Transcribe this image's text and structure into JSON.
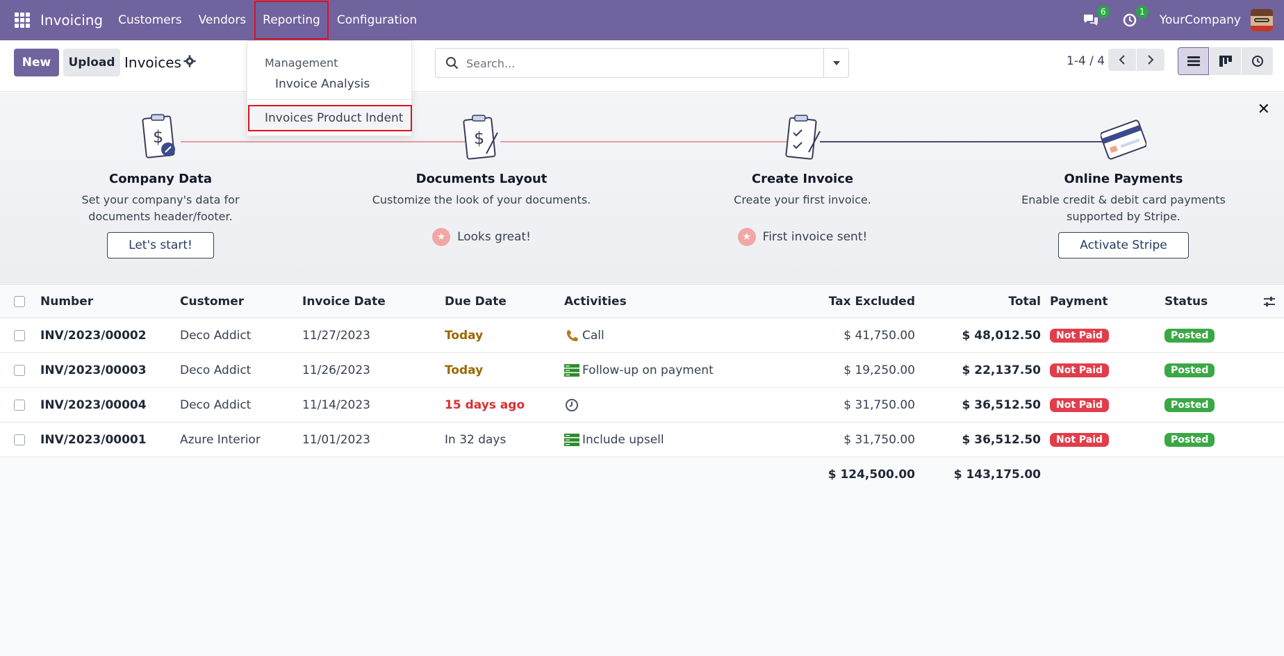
{
  "navbar": {
    "brand": "Invoicing",
    "menu": [
      "Customers",
      "Vendors",
      "Reporting",
      "Configuration"
    ],
    "messages_count": "6",
    "activities_count": "1",
    "company": "YourCompany"
  },
  "reporting_menu": {
    "section_header": "Management",
    "items": [
      "Invoice Analysis",
      "Invoices Product Indent"
    ]
  },
  "control": {
    "new_label": "New",
    "upload_label": "Upload",
    "title": "Invoices",
    "search_placeholder": "Search...",
    "pager": "1-4 / 4"
  },
  "onboarding": {
    "steps": [
      {
        "title": "Company Data",
        "desc": "Set your company's data for documents header/footer.",
        "action": "Let's start!",
        "done": false
      },
      {
        "title": "Documents Layout",
        "desc": "Customize the look of your documents.",
        "action": "Looks great!",
        "done": true
      },
      {
        "title": "Create Invoice",
        "desc": "Create your first invoice.",
        "action": "First invoice sent!",
        "done": true
      },
      {
        "title": "Online Payments",
        "desc": "Enable credit & debit card payments supported by Stripe.",
        "action": "Activate Stripe",
        "done": false
      }
    ]
  },
  "table": {
    "columns": [
      "Number",
      "Customer",
      "Invoice Date",
      "Due Date",
      "Activities",
      "Tax Excluded",
      "Total",
      "Payment",
      "Status"
    ],
    "rows": [
      {
        "number": "INV/2023/00002",
        "customer": "Deco Addict",
        "date": "11/27/2023",
        "due": "Today",
        "activity": "Call",
        "tax": "$ 41,750.00",
        "total": "$ 48,012.50",
        "payment": "Not Paid",
        "status": "Posted"
      },
      {
        "number": "INV/2023/00003",
        "customer": "Deco Addict",
        "date": "11/26/2023",
        "due": "Today",
        "activity": "Follow-up on payment",
        "tax": "$ 19,250.00",
        "total": "$ 22,137.50",
        "payment": "Not Paid",
        "status": "Posted"
      },
      {
        "number": "INV/2023/00004",
        "customer": "Deco Addict",
        "date": "11/14/2023",
        "due": "15 days ago",
        "activity": "",
        "tax": "$ 31,750.00",
        "total": "$ 36,512.50",
        "payment": "Not Paid",
        "status": "Posted"
      },
      {
        "number": "INV/2023/00001",
        "customer": "Azure Interior",
        "date": "11/01/2023",
        "due": "In 32 days",
        "activity": "Include upsell",
        "tax": "$ 31,750.00",
        "total": "$ 36,512.50",
        "payment": "Not Paid",
        "status": "Posted"
      }
    ],
    "totals": {
      "tax": "$ 124,500.00",
      "total": "$ 143,175.00"
    }
  },
  "icons": {
    "apps": "apps-grid-icon",
    "messages": "chat-bubbles-icon",
    "activities": "clock-icon",
    "phone": "phone-icon",
    "todo": "list-lines-icon",
    "settings": "gear-icon"
  },
  "colors": {
    "brand": "#71639e",
    "danger": "#e23d4b",
    "success": "#3aa845",
    "warning_text": "#9a6700"
  }
}
